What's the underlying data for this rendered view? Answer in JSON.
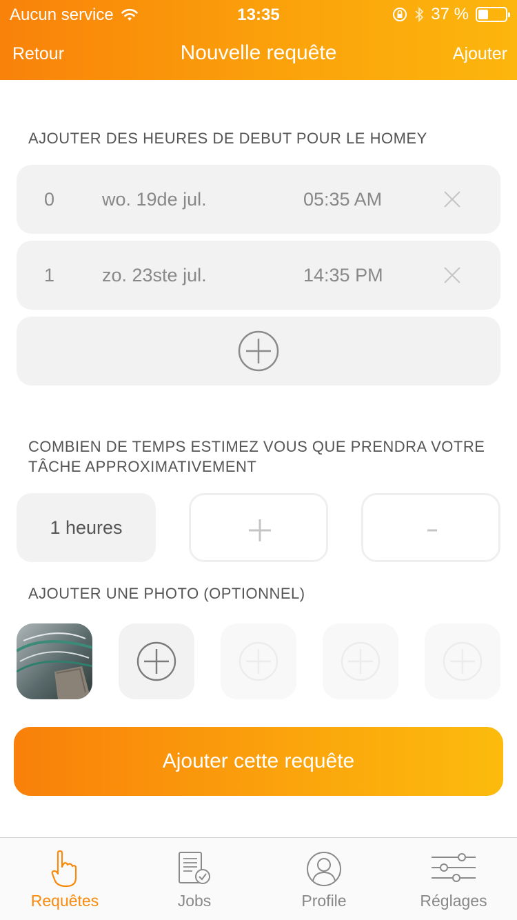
{
  "status_bar": {
    "carrier": "Aucun service",
    "time": "13:35",
    "battery": "37 %",
    "battery_level": 0.37
  },
  "nav": {
    "back_label": "Retour",
    "title": "Nouvelle requête",
    "add_label": "Ajouter"
  },
  "start_times": {
    "section_title": "AJOUTER DES HEURES DE DEBUT POUR LE HOMEY",
    "items": [
      {
        "index": "0",
        "date": "wo. 19de jul.",
        "time": "05:35 AM"
      },
      {
        "index": "1",
        "date": "zo. 23ste jul.",
        "time": "14:35 PM"
      }
    ]
  },
  "duration": {
    "section_title": "COMBIEN DE TEMPS ESTIMEZ VOUS QUE PRENDRA VOTRE TÂCHE APPROXIMATIVEMENT",
    "value": "1 heures",
    "increment_label": "+",
    "decrement_label": "-"
  },
  "photos": {
    "section_title": "AJOUTER UNE PHOTO (OPTIONNEL)"
  },
  "cta_label": "Ajouter cette requête",
  "tabs": [
    {
      "label": "Requêtes",
      "icon": "pointing-hand-icon",
      "active": true
    },
    {
      "label": "Jobs",
      "icon": "document-check-icon",
      "active": false
    },
    {
      "label": "Profile",
      "icon": "user-circle-icon",
      "active": false
    },
    {
      "label": "Réglages",
      "icon": "sliders-icon",
      "active": false
    }
  ],
  "colors": {
    "accent_start": "#f9820a",
    "accent_end": "#fcb60d",
    "active_tab": "#f98a0b"
  }
}
